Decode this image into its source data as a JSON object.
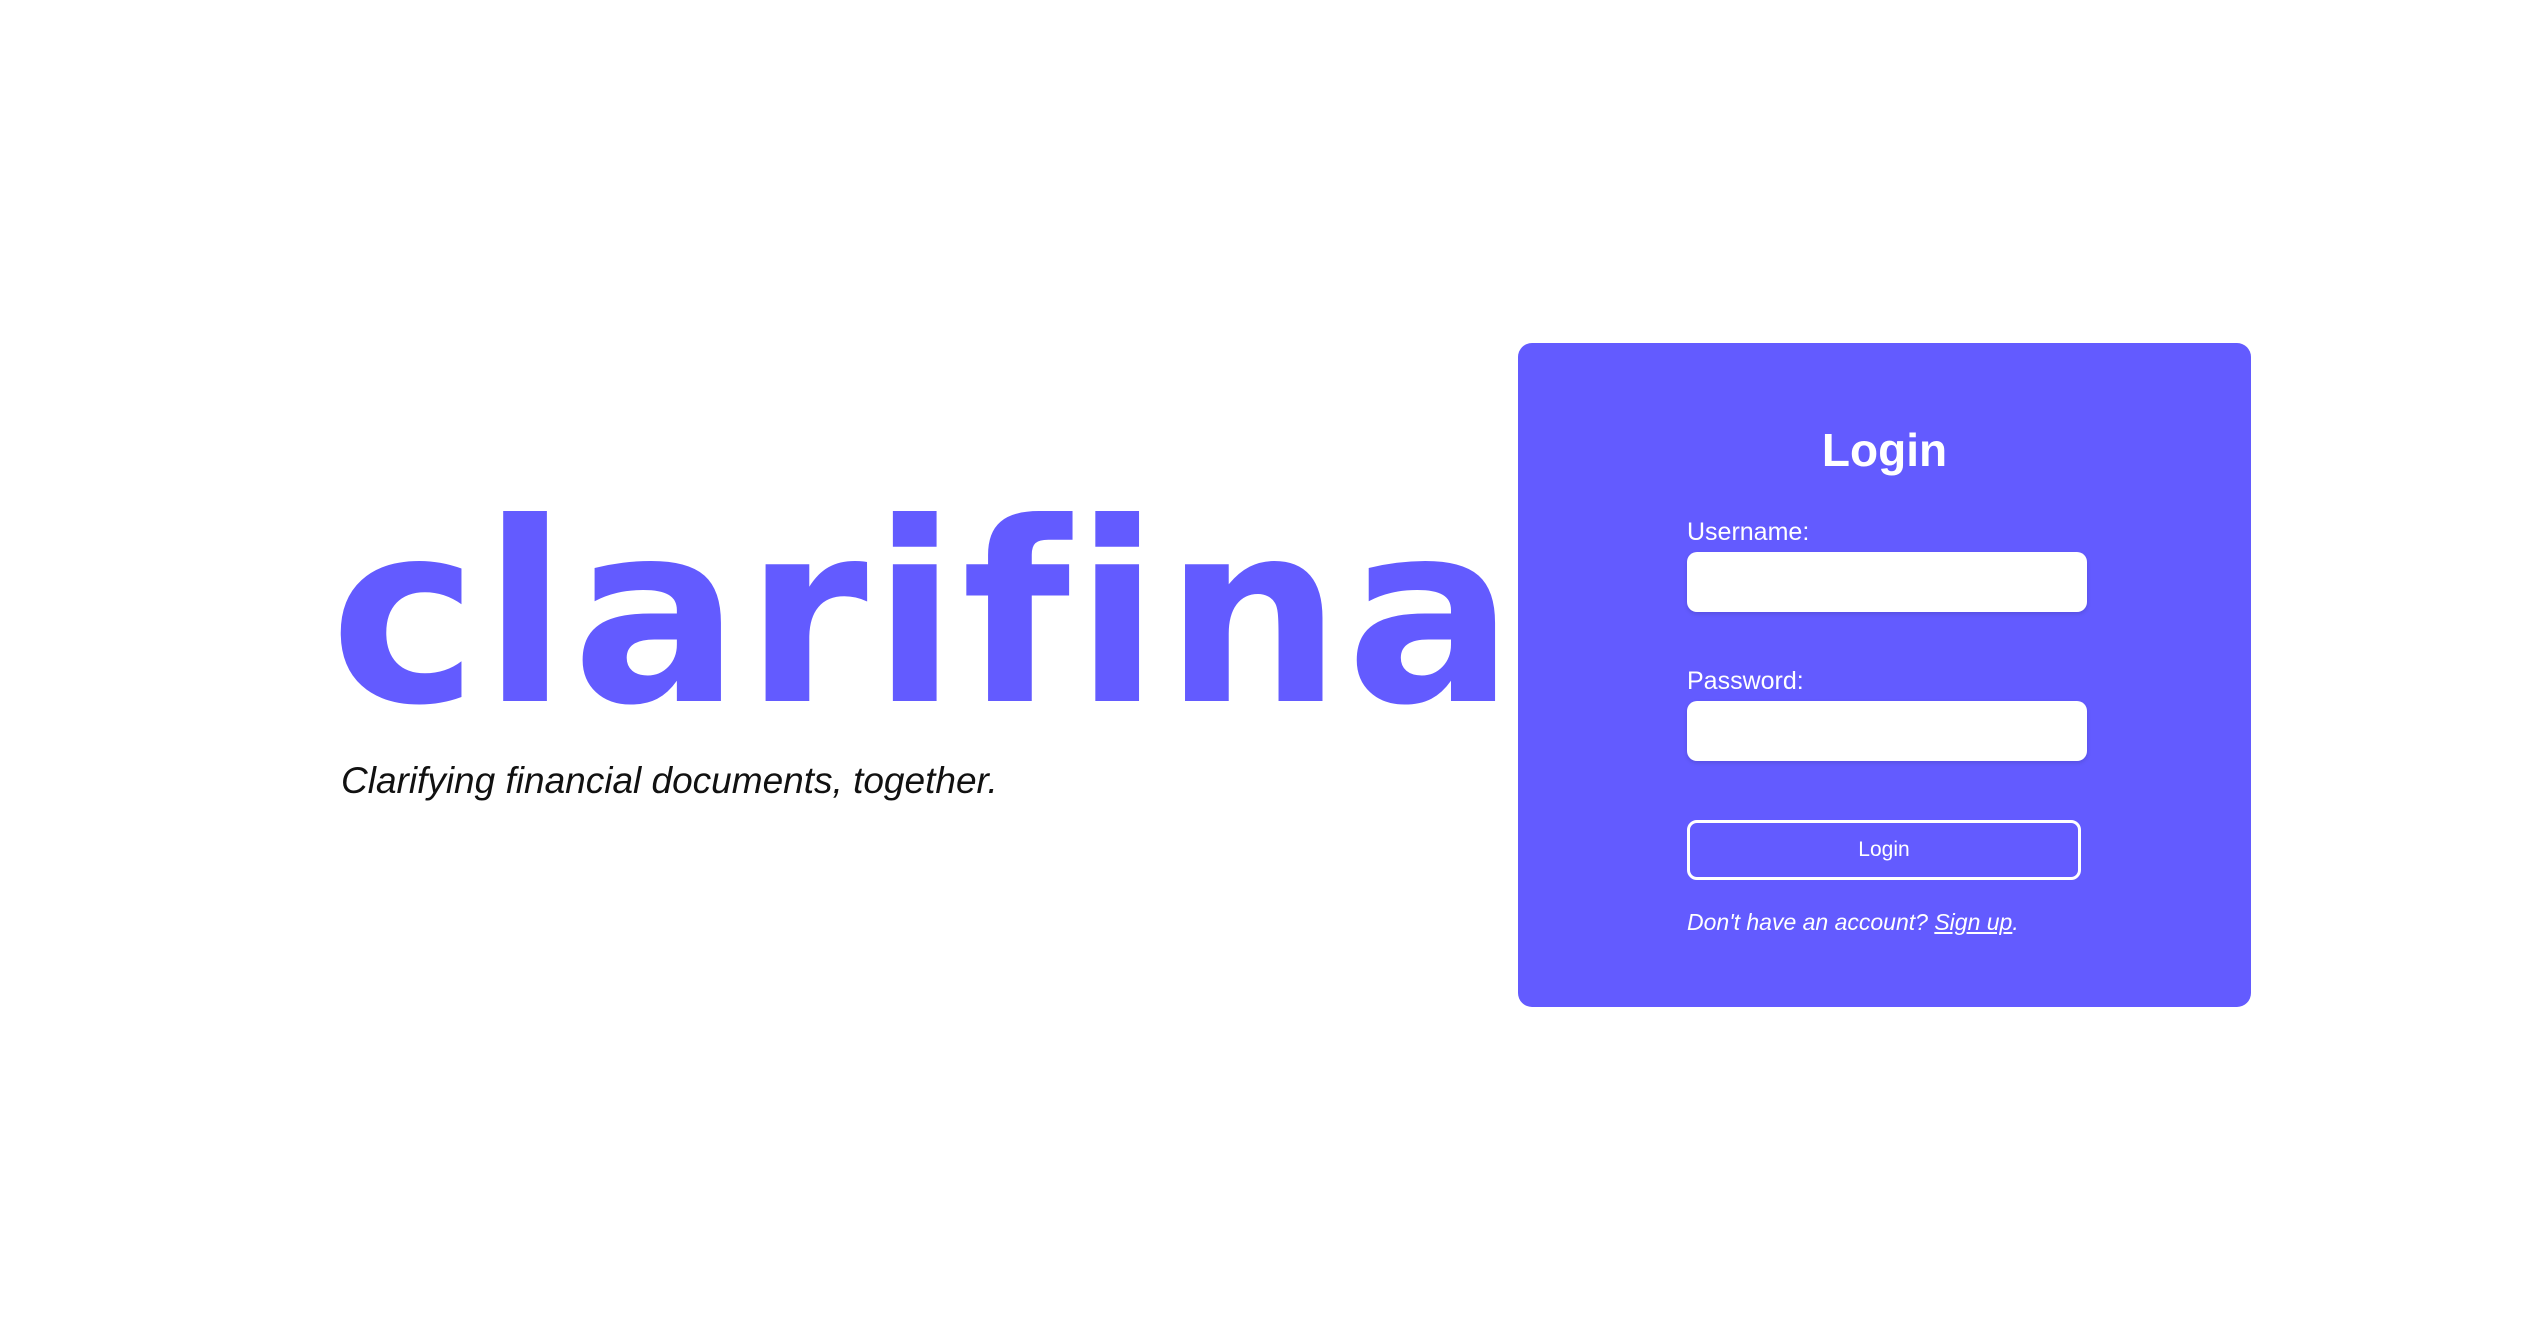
{
  "brand": {
    "logo_text": "clarifina",
    "tagline": "Clarifying financial documents, together."
  },
  "login_card": {
    "title": "Login",
    "username_label": "Username:",
    "username_value": "",
    "password_label": "Password:",
    "password_value": "",
    "submit_label": "Login",
    "signup_prompt": "Don't have an account?",
    "signup_link": "Sign up",
    "signup_suffix": "."
  },
  "colors": {
    "accent": "#635BFF",
    "background": "#FFFFFF",
    "text_dark": "#111111",
    "text_light": "#FFFFFF"
  }
}
